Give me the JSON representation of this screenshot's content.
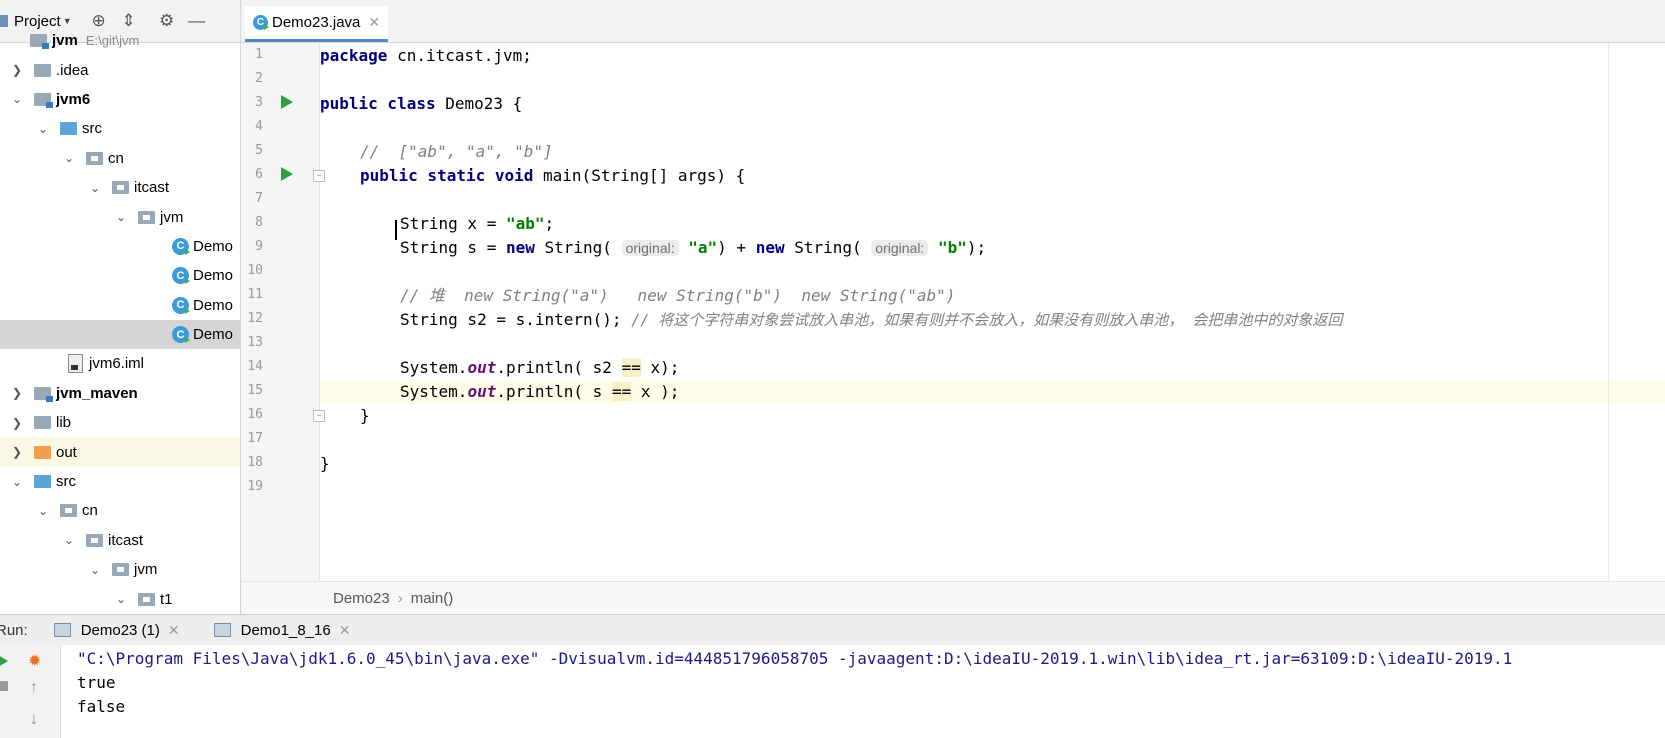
{
  "project_panel": {
    "title": "Project",
    "tree": [
      {
        "label": "jvm",
        "path": "E:\\git\\jvm",
        "bold": true
      },
      {
        "label": ".idea"
      },
      {
        "label": "jvm6",
        "bold": true
      },
      {
        "label": "src"
      },
      {
        "label": "cn"
      },
      {
        "label": "itcast"
      },
      {
        "label": "jvm"
      },
      {
        "label": "Demo"
      },
      {
        "label": "Demo"
      },
      {
        "label": "Demo"
      },
      {
        "label": "Demo"
      },
      {
        "label": "jvm6.iml"
      },
      {
        "label": "jvm_maven",
        "bold": true
      },
      {
        "label": "lib"
      },
      {
        "label": "out"
      },
      {
        "label": "src"
      },
      {
        "label": "cn"
      },
      {
        "label": "itcast"
      },
      {
        "label": "jvm"
      },
      {
        "label": "t1"
      }
    ]
  },
  "editor": {
    "tab_label": "Demo23.java",
    "line_numbers": [
      "1",
      "2",
      "3",
      "4",
      "5",
      "6",
      "7",
      "8",
      "9",
      "10",
      "11",
      "12",
      "13",
      "14",
      "15",
      "16",
      "17",
      "18",
      "19"
    ],
    "code": {
      "l1_kw": "package",
      "l1_rest": " cn.itcast.jvm;",
      "l3_kw": "public class",
      "l3_rest": " Demo23 {",
      "l5_comment": "//  [\"ab\", \"a\", \"b\"]",
      "l6_kw": "public static void",
      "l6_rest": " main(String[] args) {",
      "l8_a": "String x = ",
      "l8_str": "\"ab\"",
      "l8_b": ";",
      "l9_a": "String s = ",
      "l9_new1": "new",
      "l9_b": " String( ",
      "l9_hint1": "original:",
      "l9_str1": "\"a\"",
      "l9_c": ") + ",
      "l9_new2": "new",
      "l9_d": " String( ",
      "l9_hint2": "original:",
      "l9_str2": "\"b\"",
      "l9_e": ");",
      "l11_comment": "// 堆  new String(\"a\")   new String(\"b\")  new String(\"ab\")",
      "l12_a": "String s2 = s.intern(); ",
      "l12_comment": "// 将这个字符串对象尝试放入串池，如果有则并不会放入，如果没有则放入串池， 会把串池中的对象返回",
      "l14_a": "System.",
      "l14_out": "out",
      "l14_b": ".println( s2 ",
      "l14_eq": "==",
      "l14_c": " x);",
      "l15_a": "System.",
      "l15_out": "out",
      "l15_b": ".println( s ",
      "l15_eq": "==",
      "l15_c": " x );",
      "l16": "}",
      "l18": "}"
    },
    "breadcrumb": [
      "Demo23",
      "main()"
    ],
    "breadcrumb_sep": "›"
  },
  "run_panel": {
    "label": "Run:",
    "tabs": [
      "Demo23 (1)",
      "Demo1_8_16"
    ],
    "console": [
      "\"C:\\Program Files\\Java\\jdk1.6.0_45\\bin\\java.exe\" -Dvisualvm.id=444851796058705 -javaagent:D:\\ideaIU-2019.1.win\\lib\\idea_rt.jar=63109:D:\\ideaIU-2019.1",
      "true",
      "false"
    ]
  }
}
